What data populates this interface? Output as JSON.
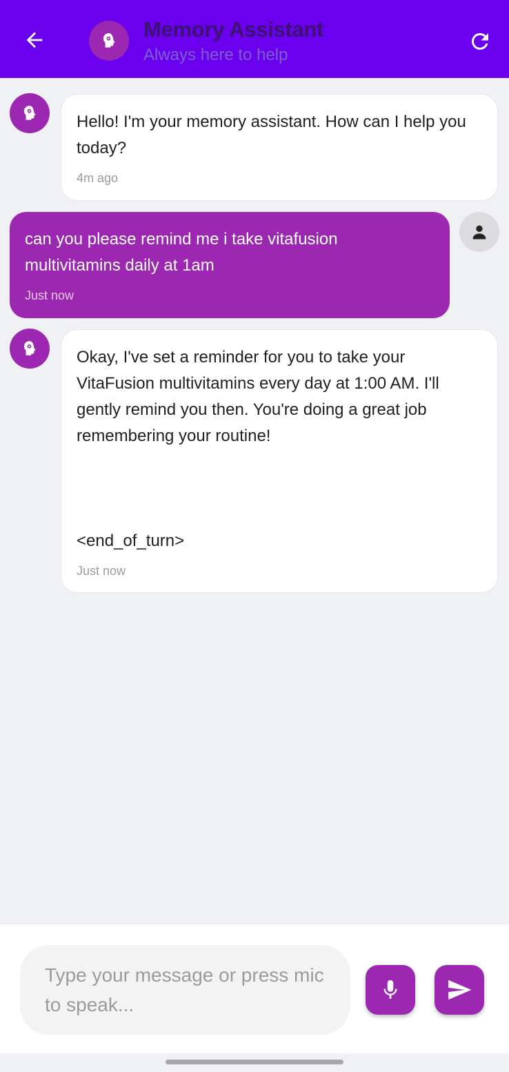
{
  "header": {
    "title": "Memory Assistant",
    "subtitle": "Always here to help",
    "back_icon": "arrow-left-icon",
    "logo_icon": "brain-head-icon",
    "refresh_icon": "refresh-icon"
  },
  "colors": {
    "appbar": "#6a00ee",
    "accent": "#9c27b0",
    "background": "#f0f1f5"
  },
  "messages": [
    {
      "sender": "assistant",
      "text": "Hello! I'm your memory assistant. How can I help you today?",
      "time": "4m ago"
    },
    {
      "sender": "user",
      "text": "can you please remind me i take vitafusion multivitamins daily at 1am",
      "time": "Just now"
    },
    {
      "sender": "assistant",
      "text": "Okay, I've set a reminder for you to take your VitaFusion multivitamins every day at 1:00 AM. I'll gently remind you then. You're doing a great job remembering your routine!\n\n\n\n<end_of_turn>",
      "time": "Just now"
    }
  ],
  "composer": {
    "placeholder": "Type your message or press mic to speak...",
    "mic_icon": "microphone-icon",
    "send_icon": "send-icon"
  }
}
